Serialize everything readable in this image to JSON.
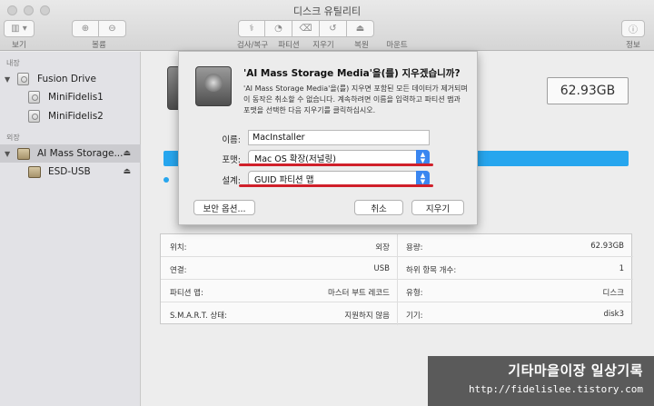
{
  "window": {
    "title": "디스크 유틸리티"
  },
  "toolbar": {
    "view_label": "보기",
    "volume_label": "볼륨",
    "first_aid_label": "검사/복구",
    "partition_label": "파티션",
    "erase_label": "지우기",
    "restore_label": "복원",
    "mount_label": "마운트",
    "info_label": "정보"
  },
  "sidebar": {
    "internal_header": "내장",
    "external_header": "외장",
    "items": [
      {
        "label": "Fusion Drive"
      },
      {
        "label": "MiniFidelis1"
      },
      {
        "label": "MiniFidelis2"
      },
      {
        "label": "AI Mass Storage..."
      },
      {
        "label": "ESD-USB"
      }
    ]
  },
  "main": {
    "capacity": "62.93GB",
    "info": {
      "left": [
        {
          "key": "위치:",
          "value": "외장"
        },
        {
          "key": "연결:",
          "value": "USB"
        },
        {
          "key": "파티션 맵:",
          "value": "마스터 부트 레코드"
        },
        {
          "key": "S.M.A.R.T. 상태:",
          "value": "지원하지 않음"
        }
      ],
      "right": [
        {
          "key": "용량:",
          "value": "62.93GB"
        },
        {
          "key": "하위 항목 개수:",
          "value": "1"
        },
        {
          "key": "유형:",
          "value": "디스크"
        },
        {
          "key": "기기:",
          "value": "disk3"
        }
      ]
    }
  },
  "dialog": {
    "title": "'AI Mass Storage Media'을(를) 지우겠습니까?",
    "description": "'AI Mass Storage Media'을(를) 지우면 포함된 모든 데이터가 제거되며 이 동작은 취소할 수 없습니다. 계속하려면 이름을 입력하고 파티션 맵과 포맷을 선택한 다음 지우기를 클릭하십시오.",
    "name_label": "이름:",
    "name_value": "MacInstaller",
    "format_label": "포맷:",
    "format_value": "Mac OS 확장(저널링)",
    "scheme_label": "설계:",
    "scheme_value": "GUID 파티션 맵",
    "security_button": "보안 옵션...",
    "cancel_button": "취소",
    "erase_button": "지우기"
  },
  "watermark": {
    "line1": "기타마을이장 일상기록",
    "line2": "http://fidelislee.tistory.com"
  }
}
